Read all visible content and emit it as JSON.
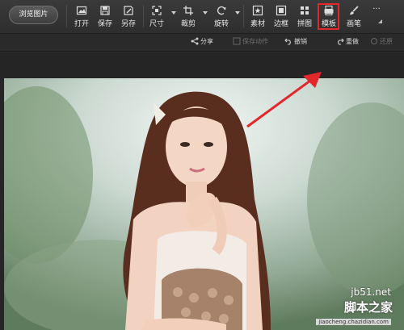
{
  "toolbar": {
    "browse_label": "浏览图片",
    "tools": [
      {
        "label": "打开",
        "icon": "open-icon"
      },
      {
        "label": "保存",
        "icon": "save-icon"
      },
      {
        "label": "另存",
        "icon": "save-as-icon"
      },
      {
        "label": "尺寸",
        "icon": "resize-icon"
      },
      {
        "label": "裁剪",
        "icon": "crop-icon"
      },
      {
        "label": "旋转",
        "icon": "rotate-icon"
      },
      {
        "label": "素材",
        "icon": "material-icon"
      },
      {
        "label": "边框",
        "icon": "frame-icon"
      },
      {
        "label": "拼图",
        "icon": "collage-icon"
      },
      {
        "label": "模板",
        "icon": "template-icon"
      },
      {
        "label": "画笔",
        "icon": "brush-icon"
      }
    ],
    "more": "···"
  },
  "subbar": {
    "share": "分享",
    "save_action": "保存动作",
    "undo": "撤销",
    "redo": "重做",
    "restore": "还原"
  },
  "watermark": {
    "site": "jb51.net",
    "text": "脚本之家",
    "url": "jiaocheng.chazidian.com"
  },
  "colors": {
    "highlight": "#e3272b",
    "toolbar_bg": "#333333"
  }
}
